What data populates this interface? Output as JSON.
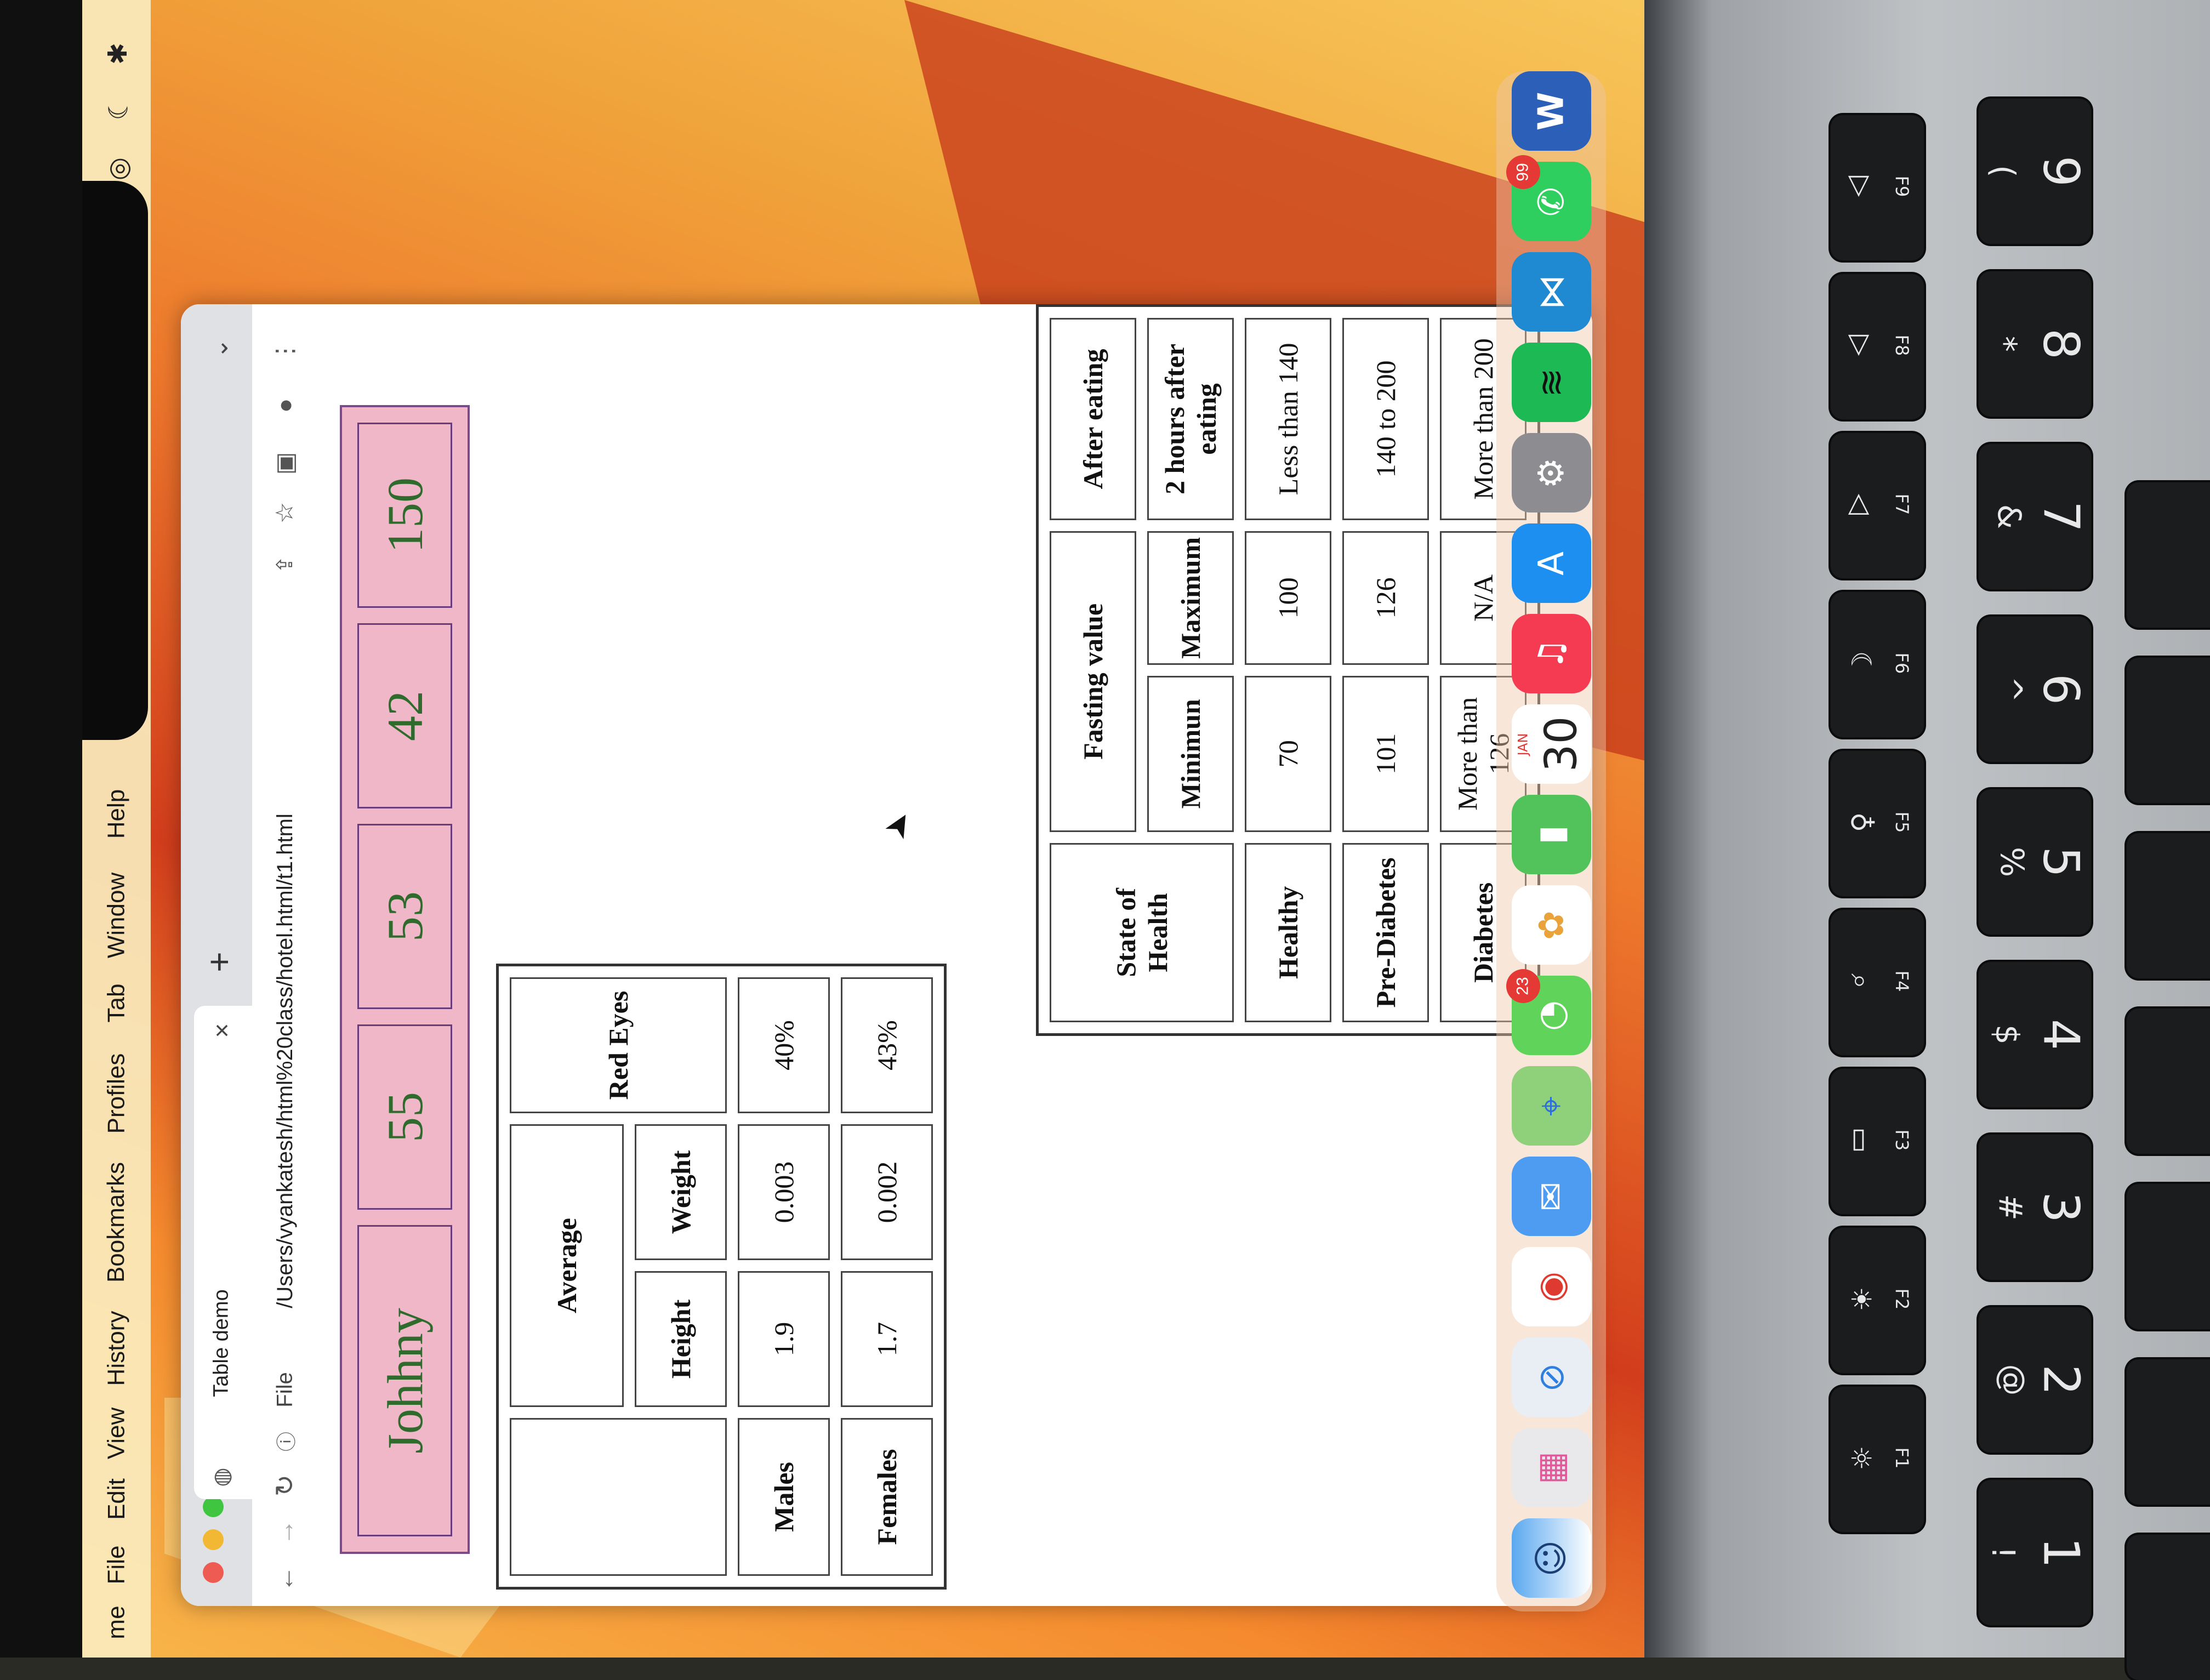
{
  "menubar": {
    "app_fragment": "me",
    "items": [
      "File",
      "Edit",
      "View",
      "History",
      "Bookmarks",
      "Profiles",
      "Tab",
      "Window",
      "Help"
    ]
  },
  "browser": {
    "tab_title": "Table demo",
    "tab_close": "×",
    "new_tab": "+",
    "address_prefix": "File",
    "address": "/Users/vyankatesh/html%20class/hotel.html/t1.html",
    "menu": "⋮",
    "chevron": "⌄"
  },
  "table1": {
    "cells": [
      "Johhny",
      "55",
      "53",
      "42",
      "150"
    ]
  },
  "table2": {
    "header_top": [
      "",
      "Average",
      "Red Eyes"
    ],
    "header_sub": [
      "Height",
      "Weight"
    ],
    "rows": [
      {
        "label": "Males",
        "height": "1.9",
        "weight": "0.003",
        "red_eyes": "40%"
      },
      {
        "label": "Females",
        "height": "1.7",
        "weight": "0.002",
        "red_eyes": "43%"
      }
    ]
  },
  "table3": {
    "h_state": "State of Health",
    "h_fasting": "Fasting value",
    "h_after": "After eating",
    "h_min": "Minimun",
    "h_max": "Maximum",
    "h_2hours": "2 hours after eating",
    "rows": [
      {
        "state": "Healthy",
        "min": "70",
        "max": "100",
        "after": "Less than 140"
      },
      {
        "state": "Pre-Diabetes",
        "min": "101",
        "max": "126",
        "after": "140 to 200"
      },
      {
        "state": "Diabetes",
        "min": "More than 126",
        "max": "N/A",
        "after": "More than 200"
      }
    ]
  },
  "dock": {
    "calendar_month": "JAN",
    "calendar_day": "30",
    "messages_badge": "23",
    "whatsapp_badge": "99",
    "word_letter": "W"
  },
  "keyboard": {
    "fkeys": [
      "F1",
      "F2",
      "F3",
      "F4",
      "F5",
      "F6",
      "F7",
      "F8",
      "F9"
    ],
    "number_keys": [
      {
        "top": "!",
        "bottom": "1"
      },
      {
        "top": "@",
        "bottom": "2"
      },
      {
        "top": "#",
        "bottom": "3"
      },
      {
        "top": "$",
        "bottom": "4"
      },
      {
        "top": "%",
        "bottom": "5"
      },
      {
        "top": "^",
        "bottom": "6"
      },
      {
        "top": "&",
        "bottom": "7"
      },
      {
        "top": "*",
        "bottom": "8"
      },
      {
        "top": "(",
        "bottom": "9"
      }
    ]
  }
}
